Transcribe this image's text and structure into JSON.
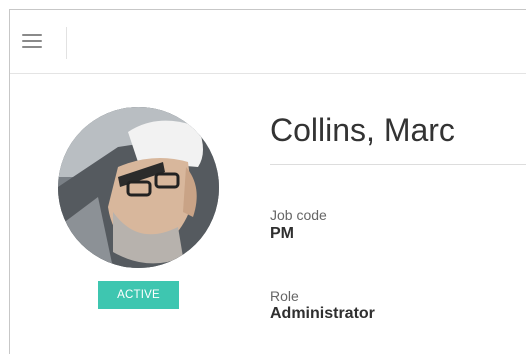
{
  "header": {
    "menu_icon": "hamburger-menu-icon"
  },
  "profile": {
    "name": "Collins, Marc",
    "status": "ACTIVE",
    "status_color": "#3ec6b0",
    "fields": [
      {
        "label": "Job code",
        "value": "PM"
      },
      {
        "label": "Role",
        "value": "Administrator"
      }
    ]
  }
}
